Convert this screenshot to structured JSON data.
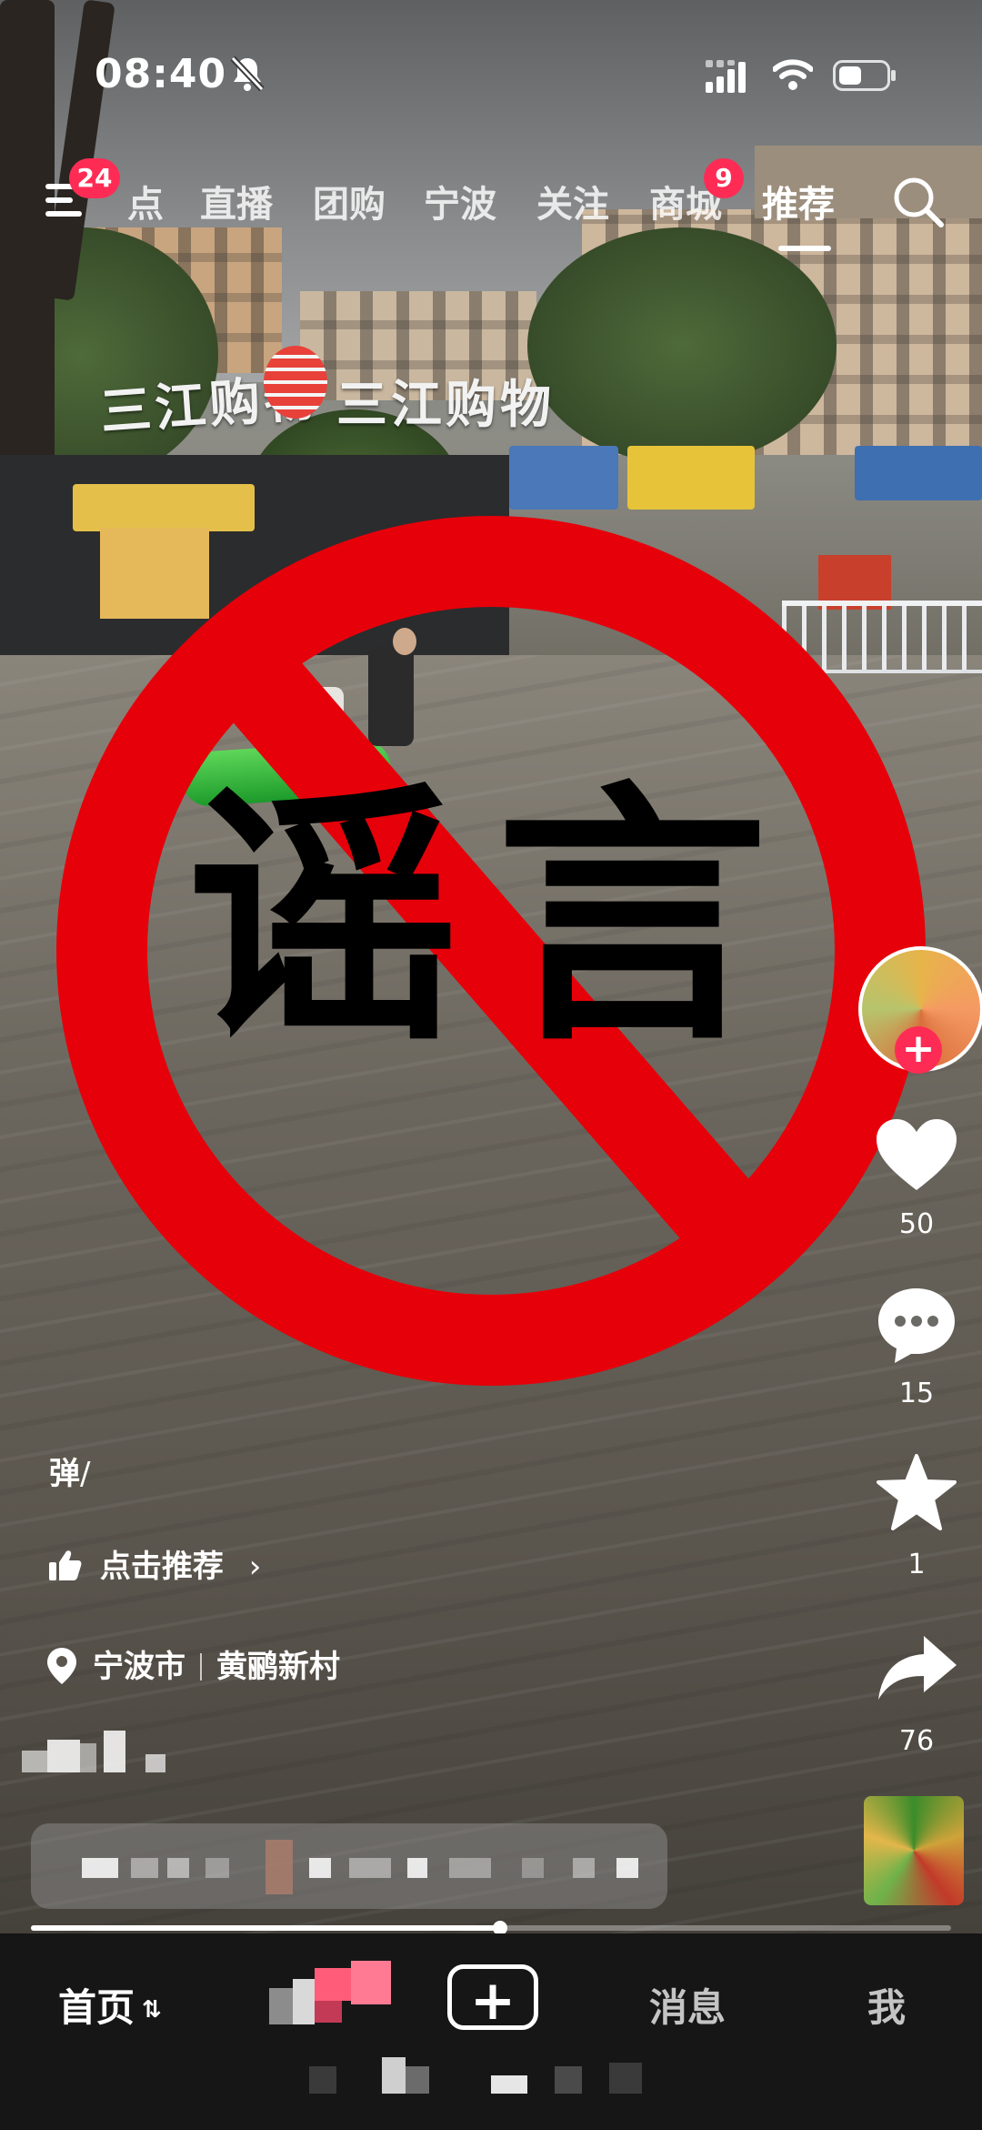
{
  "status_bar": {
    "time": "08:40"
  },
  "top_nav": {
    "menu_badge": "24",
    "tabs": [
      {
        "label": "点",
        "active": false
      },
      {
        "label": "直播",
        "active": false
      },
      {
        "label": "团购",
        "active": false
      },
      {
        "label": "宁波",
        "active": false
      },
      {
        "label": "关注",
        "active": false
      },
      {
        "label": "商城",
        "active": false,
        "badge": "9"
      },
      {
        "label": "推荐",
        "active": true
      }
    ]
  },
  "overlay": {
    "stamp_text": "谣言",
    "stamp_color": "#e6000a"
  },
  "scene": {
    "shop_sign_text": "三江购物"
  },
  "right_rail": {
    "like_count": "50",
    "comment_count": "15",
    "favorite_count": "1",
    "share_count": "76"
  },
  "video_info": {
    "danmaku_label": "弹",
    "recommend_label": "点击推荐",
    "location_city": "宁波市",
    "location_place": "黄鹂新村",
    "progress": 0.51
  },
  "tab_bar": {
    "home_label": "首页",
    "messages_label": "消息",
    "me_label": "我"
  },
  "colors": {
    "accent": "#fe2c55",
    "tab_bar_bg": "#161616"
  }
}
